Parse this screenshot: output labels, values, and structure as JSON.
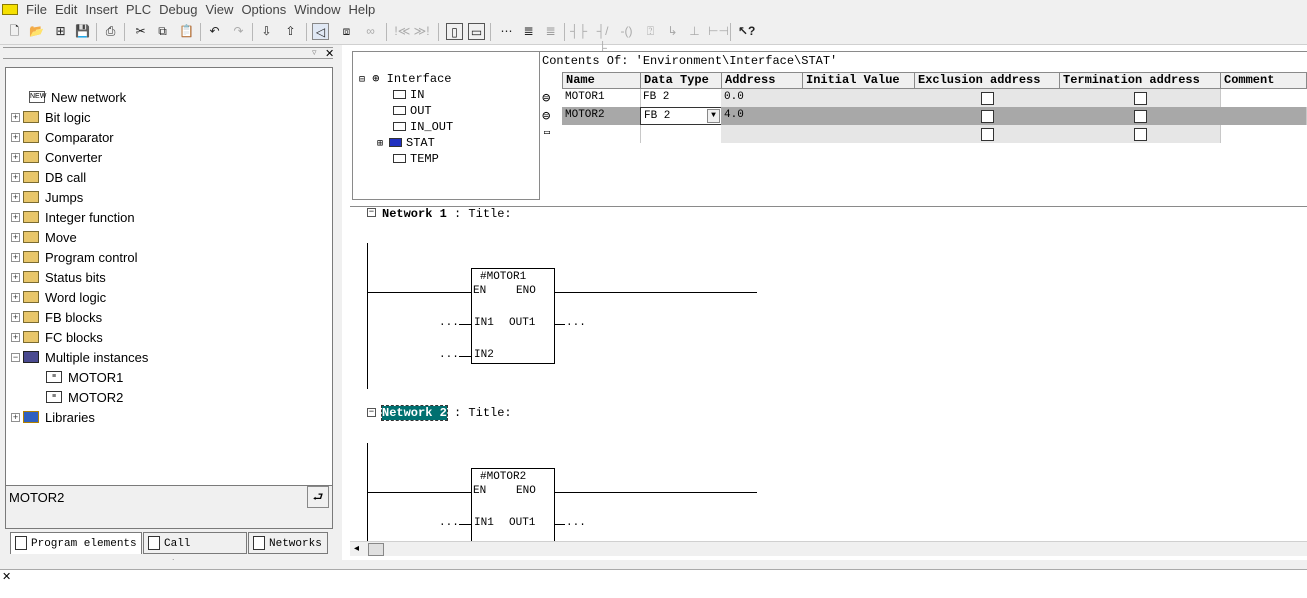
{
  "menu": [
    "File",
    "Edit",
    "Insert",
    "PLC",
    "Debug",
    "View",
    "Options",
    "Window",
    "Help"
  ],
  "left_tree": {
    "items": [
      {
        "label": "New network",
        "expandable": false,
        "icon": "new-network-icon"
      },
      {
        "label": "Bit logic",
        "expandable": true,
        "icon": "bit-logic-icon"
      },
      {
        "label": "Comparator",
        "expandable": true,
        "icon": "comparator-icon"
      },
      {
        "label": "Converter",
        "expandable": true,
        "icon": "converter-icon"
      },
      {
        "label": "DB call",
        "expandable": true,
        "icon": "db-call-icon"
      },
      {
        "label": "Jumps",
        "expandable": true,
        "icon": "jumps-icon"
      },
      {
        "label": "Integer function",
        "expandable": true,
        "icon": "integer-function-icon"
      },
      {
        "label": "Move",
        "expandable": true,
        "icon": "move-icon"
      },
      {
        "label": "Program control",
        "expandable": true,
        "icon": "program-control-icon"
      },
      {
        "label": "Status bits",
        "expandable": true,
        "icon": "status-bits-icon"
      },
      {
        "label": "Word logic",
        "expandable": true,
        "icon": "word-logic-icon"
      },
      {
        "label": "FB blocks",
        "expandable": true,
        "icon": "fb-blocks-icon"
      },
      {
        "label": "FC blocks",
        "expandable": true,
        "icon": "fc-blocks-icon"
      },
      {
        "label": "Multiple instances",
        "expandable": true,
        "expanded": true,
        "icon": "multiple-instances-icon"
      },
      {
        "label": "MOTOR1",
        "expandable": false,
        "indent": true,
        "icon": "instance-icon"
      },
      {
        "label": "MOTOR2",
        "expandable": false,
        "indent": true,
        "icon": "instance-icon"
      },
      {
        "label": "Libraries",
        "expandable": true,
        "icon": "libraries-icon"
      }
    ],
    "status_text": "MOTOR2"
  },
  "tabs": [
    "Program elements",
    "Call struc...",
    "Networks"
  ],
  "interface_tree": {
    "root": "Interface",
    "children": [
      "IN",
      "OUT",
      "IN_OUT",
      "STAT",
      "TEMP"
    ]
  },
  "contents": {
    "title": "Contents Of: 'Environment\\Interface\\STAT'",
    "columns": [
      "Name",
      "Data Type",
      "Address",
      "Initial Value",
      "Exclusion address",
      "Termination address",
      "Comment"
    ],
    "rows": [
      {
        "name": "MOTOR1",
        "type": "FB 2",
        "address": "0.0"
      },
      {
        "name": "MOTOR2",
        "type": "FB 2",
        "address": "4.0"
      }
    ]
  },
  "networks": [
    {
      "title": "Network 1",
      "sep": ":",
      "subtitle": "Title:",
      "instance": "#MOTOR1",
      "en": "EN",
      "eno": "ENO",
      "in1": "IN1",
      "out1": "OUT1",
      "in2": "IN2",
      "dots": "..."
    },
    {
      "title": "Network 2",
      "sep": ":",
      "subtitle": "Title:",
      "instance": "#MOTOR2",
      "en": "EN",
      "eno": "ENO",
      "in1": "IN1",
      "out1": "OUT1",
      "dots": "..."
    }
  ],
  "colors": {
    "highlight": "#007070",
    "selected_row": "#a8a8a8",
    "folder_icon": "#e8c66a"
  }
}
